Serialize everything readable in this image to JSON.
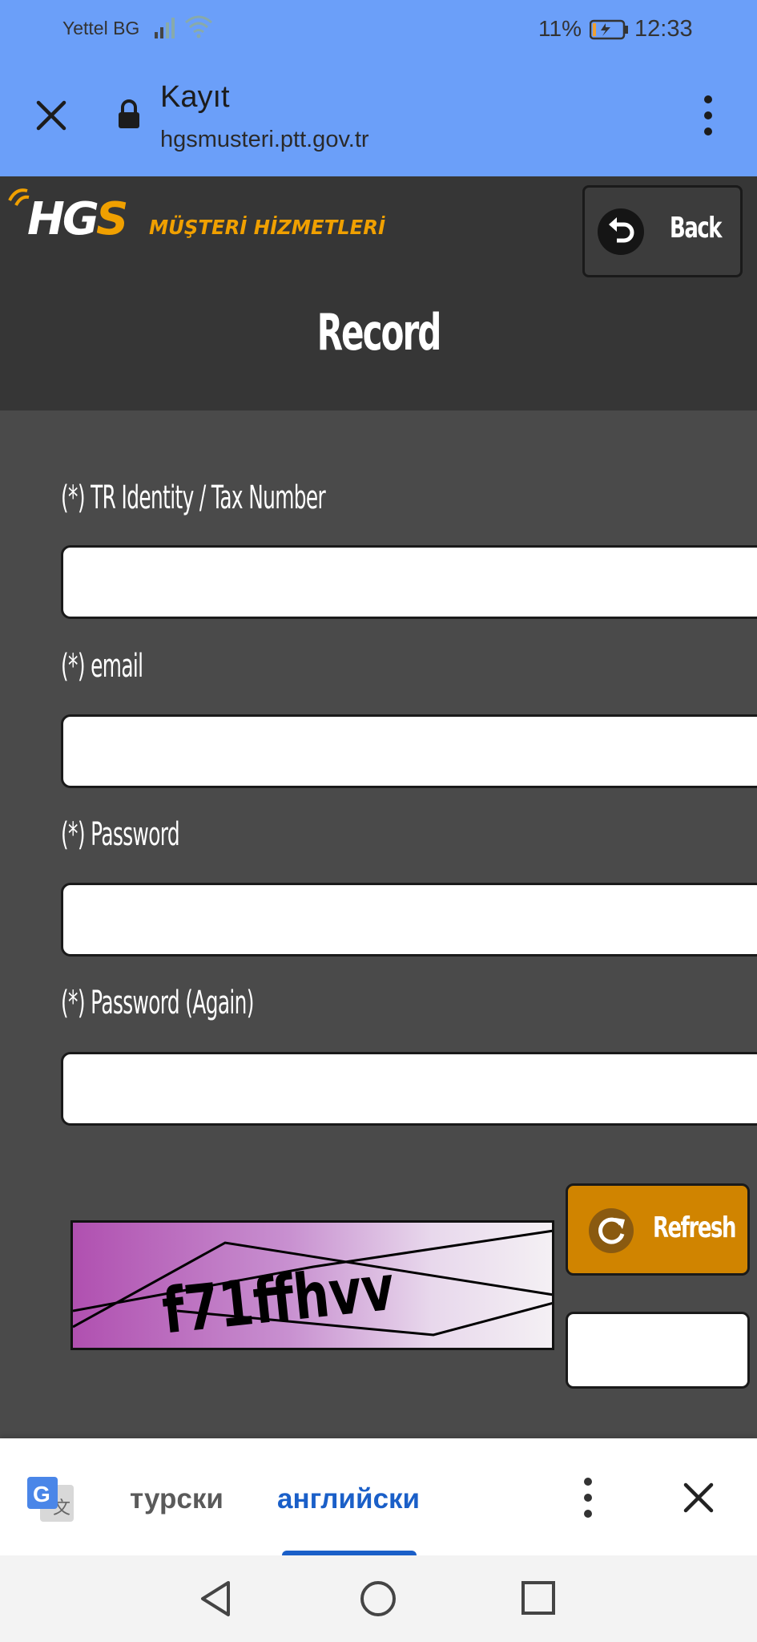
{
  "status_bar": {
    "carrier": "Yettel BG",
    "battery_percent": "11%",
    "battery_level": 0.11,
    "time": "12:33",
    "icons": [
      "signal-icon",
      "wifi-icon",
      "battery-icon"
    ]
  },
  "browser": {
    "page_title": "Kayıt",
    "url": "hgsmusteri.ptt.gov.tr",
    "icons": [
      "close-icon",
      "lock-icon",
      "more-vert-icon"
    ]
  },
  "header": {
    "logo_text": "HGS MÜŞTERİ HİZMETLERİ",
    "back_label": "Back",
    "page_heading": "Record"
  },
  "form": {
    "fields": [
      {
        "label": "(*) TR Identity / Tax Number",
        "value": ""
      },
      {
        "label": "(*) email",
        "value": ""
      },
      {
        "label": "(*) Password",
        "value": ""
      },
      {
        "label": "(*) Password (Again)",
        "value": ""
      }
    ],
    "captcha_text": "f71ffhvv",
    "refresh_label": "Refresh",
    "captcha_input_value": ""
  },
  "translate_bar": {
    "source_language": "турски",
    "target_language": "английски",
    "icons": [
      "google-translate-icon",
      "more-vert-icon",
      "close-icon"
    ]
  },
  "colors": {
    "browser_bar": "#6b9ff9",
    "header_bg": "#363636",
    "form_bg": "#4a4a4a",
    "refresh_button": "#d08400",
    "translate_accent": "#1a5fc8",
    "logo_orange": "#f0a000"
  }
}
